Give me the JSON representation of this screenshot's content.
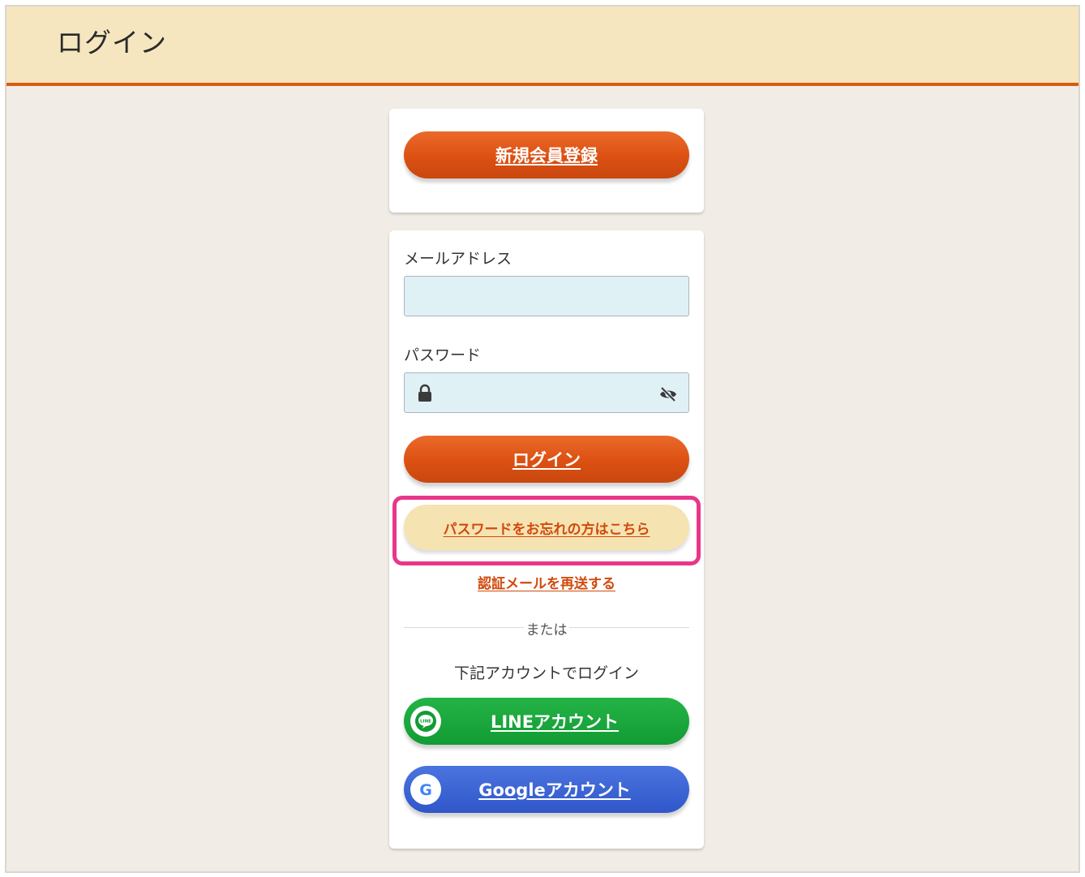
{
  "header": {
    "title": "ログイン"
  },
  "register": {
    "label": "新規会員登録"
  },
  "form": {
    "email_label": "メールアドレス",
    "email_value": "",
    "password_label": "パスワード",
    "password_value": "",
    "login_label": "ログイン",
    "forgot_label": "パスワードをお忘れの方はこちら",
    "resend_label": "認証メールを再送する"
  },
  "divider": {
    "text": "または"
  },
  "social": {
    "subtitle": "下記アカウントでログイン",
    "line_label": "LINEアカウント",
    "line_icon_text": "LINE",
    "google_label": "Googleアカウント",
    "google_icon_text": "G"
  },
  "icons": {
    "lock": "lock-icon",
    "eye": "eye-slash-icon",
    "line": "line-logo-icon",
    "google": "google-logo-icon"
  },
  "colors": {
    "accent": "#dc5012",
    "header_bg": "#f5e6bf",
    "highlight": "#e8378a",
    "line_green": "#129c34",
    "google_blue": "#2f57c9"
  }
}
